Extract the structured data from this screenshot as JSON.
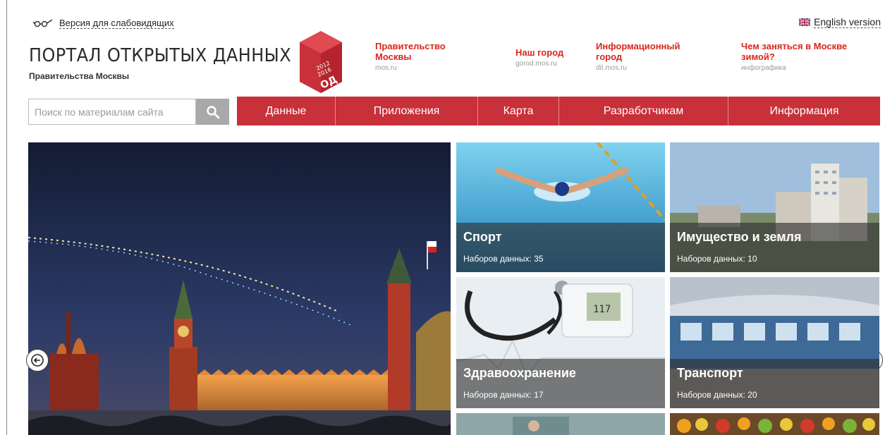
{
  "topbar": {
    "accessibility_label": "Версия для слабовидящих",
    "english_label": "English version"
  },
  "logo": {
    "title": "ПОРТАЛ ОТКРЫТЫХ ДАННЫХ",
    "subtitle": "Правительства Москвы",
    "badge_years": "2012 2016",
    "badge_abbr": "ОД"
  },
  "header_links": [
    {
      "title": "Правительство Москвы",
      "sub": "mos.ru"
    },
    {
      "title": "Наш город",
      "sub": "gorod.mos.ru"
    },
    {
      "title": "Информационный город",
      "sub": "dit.mos.ru"
    },
    {
      "title": "Чем заняться в Москве зимой?",
      "sub": "инфографика"
    }
  ],
  "search": {
    "placeholder": "Поиск по материалам сайта"
  },
  "nav": [
    {
      "label": "Данные"
    },
    {
      "label": "Приложения"
    },
    {
      "label": "Карта"
    },
    {
      "label": "Разработчикам"
    },
    {
      "label": "Информация"
    }
  ],
  "tiles": [
    {
      "title": "Спорт",
      "count": "Наборов данных: 35"
    },
    {
      "title": "Имущество и земля",
      "count": "Наборов данных: 10"
    },
    {
      "title": "Здравоохранение",
      "count": "Наборов данных: 17"
    },
    {
      "title": "Транспорт",
      "count": "Наборов данных: 20"
    }
  ],
  "icons": {
    "search": "search-icon",
    "glasses": "glasses-icon",
    "flag": "uk-flag-icon",
    "prev": "arrow-left-icon",
    "next": "arrow-right-icon"
  },
  "colors": {
    "accent": "#c8303a",
    "link_red": "#d9261c"
  }
}
